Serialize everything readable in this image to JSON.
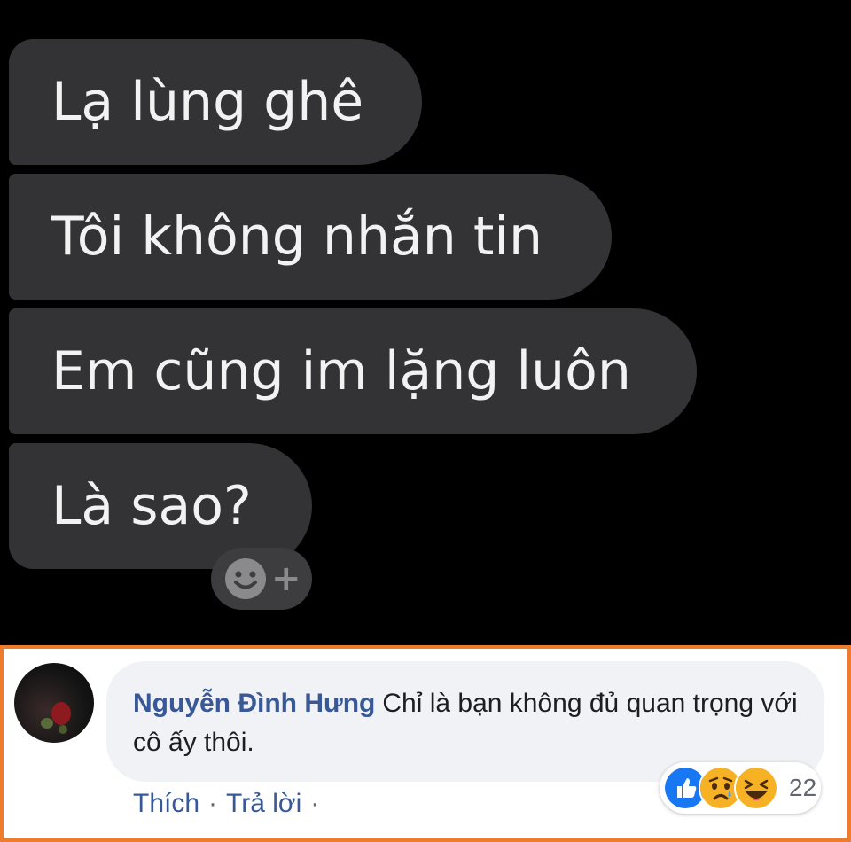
{
  "messages": [
    {
      "text": "Lạ lùng ghê"
    },
    {
      "text": "Tôi không nhắn tin"
    },
    {
      "text": "Em cũng im lặng luôn"
    },
    {
      "text": "Là sao?"
    }
  ],
  "reaction_add": {
    "icon": "smile-plus-icon",
    "plus": "+"
  },
  "comment": {
    "author": "Nguyễn Đình Hưng",
    "text": "Chỉ là bạn không đủ quan trọng với cô ấy thôi.",
    "reactions": [
      "like",
      "sad",
      "haha"
    ],
    "reaction_count": "22",
    "actions": {
      "like": "Thích",
      "separator": "·",
      "reply": "Trả lời",
      "separator2": "·"
    }
  },
  "colors": {
    "highlight_border": "#ed7d2c",
    "link": "#385898",
    "bubble_dark": "#333335"
  }
}
